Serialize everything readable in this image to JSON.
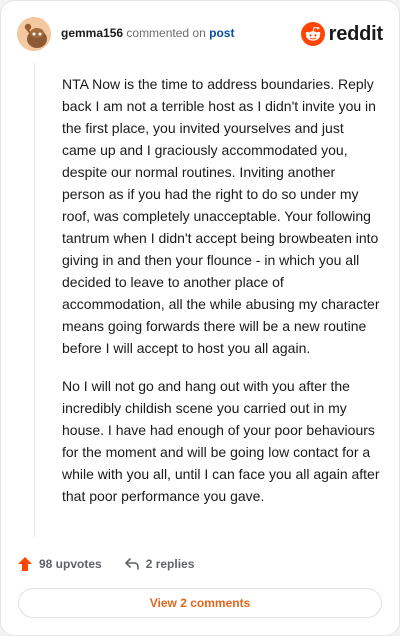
{
  "header": {
    "username": "gemma156",
    "commented_text": "commented on",
    "post_text": "post",
    "brand": "reddit",
    "avatar_icon": "reddit-avatar-icon",
    "logo_icon": "reddit-logo-icon"
  },
  "comment": {
    "paragraphs": [
      "NTA Now is the time to address boundaries. Reply back I am not a terrible host as I didn't invite you in the first place, you invited yourselves and just came up and I graciously accommodated you, despite our normal routines. Inviting another person as if you had the right to do so under my roof, was completely unacceptable. Your following tantrum when I didn't accept being browbeaten into giving in and then your flounce - in which you all decided to leave to another place of accommodation, all the while abusing my character means going forwards there will be a new routine before I will accept to host you all again.",
      "No I will not go and hang out with you after the incredibly childish scene you carried out in my house. I have had enough of your poor behaviours for the moment and will be going low contact for a while with you all, until I can face you all again after that poor performance you gave."
    ]
  },
  "footer": {
    "upvotes": "98 upvotes",
    "replies": "2 replies",
    "view_comments": "View 2 comments",
    "upvote_icon": "upvote-arrow-icon",
    "reply_icon": "reply-arrow-icon"
  },
  "colors": {
    "reddit_orange": "#FF4500",
    "link_blue": "#0B4DA2",
    "view_comments_orange": "#E1661B"
  }
}
